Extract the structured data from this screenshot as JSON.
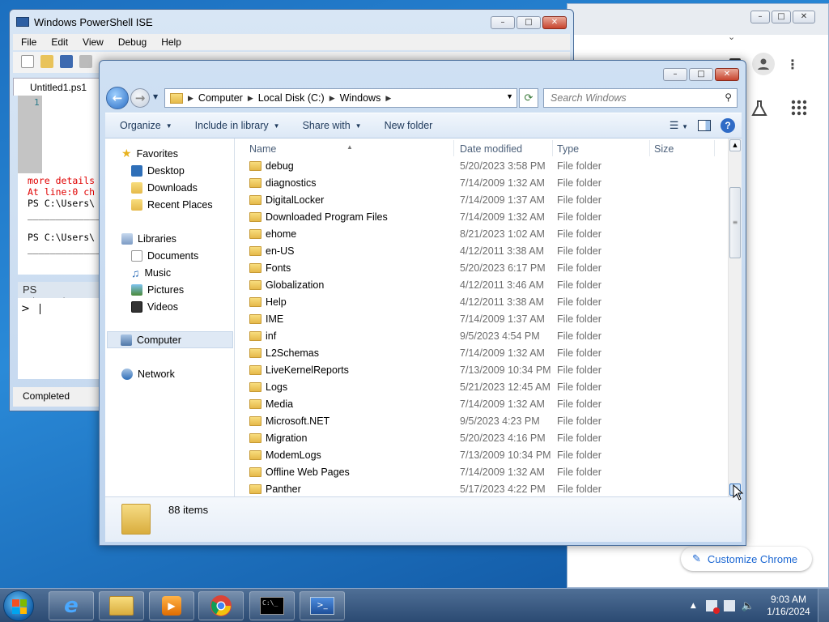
{
  "chrome": {
    "customize_label": "Customize Chrome"
  },
  "ise": {
    "title": "Windows PowerShell ISE",
    "menu": [
      "File",
      "Edit",
      "View",
      "Debug",
      "Help"
    ],
    "tab_label": "Untitled1.ps1",
    "line_number": "1",
    "console_lines": [
      {
        "text": "more details",
        "error": true
      },
      {
        "text": "At line:0 ch",
        "error": true
      },
      {
        "text": "PS C:\\Users\\",
        "error": false
      },
      {
        "text": "_____________",
        "error": false
      },
      {
        "text": "PS C:\\Users\\",
        "error": false
      },
      {
        "text": "_____________",
        "error": false
      }
    ],
    "prompt_label": "PS C:\\Users\\VM",
    "cmd_prompt": ">",
    "status": "Completed"
  },
  "explorer": {
    "address": [
      "Computer",
      "Local Disk (C:)",
      "Windows"
    ],
    "search_placeholder": "Search Windows",
    "commands": [
      "Organize",
      "Include in library",
      "Share with",
      "New folder"
    ],
    "nav": {
      "favorites_label": "Favorites",
      "favorites": [
        "Desktop",
        "Downloads",
        "Recent Places"
      ],
      "libraries_label": "Libraries",
      "libraries": [
        "Documents",
        "Music",
        "Pictures",
        "Videos"
      ],
      "computer": "Computer",
      "network": "Network"
    },
    "columns": {
      "name": "Name",
      "date": "Date modified",
      "type": "Type",
      "size": "Size"
    },
    "files": [
      {
        "name": "debug",
        "date": "5/20/2023 3:58 PM",
        "type": "File folder"
      },
      {
        "name": "diagnostics",
        "date": "7/14/2009 1:32 AM",
        "type": "File folder"
      },
      {
        "name": "DigitalLocker",
        "date": "7/14/2009 1:37 AM",
        "type": "File folder"
      },
      {
        "name": "Downloaded Program Files",
        "date": "7/14/2009 1:32 AM",
        "type": "File folder"
      },
      {
        "name": "ehome",
        "date": "8/21/2023 1:02 AM",
        "type": "File folder"
      },
      {
        "name": "en-US",
        "date": "4/12/2011 3:38 AM",
        "type": "File folder"
      },
      {
        "name": "Fonts",
        "date": "5/20/2023 6:17 PM",
        "type": "File folder"
      },
      {
        "name": "Globalization",
        "date": "4/12/2011 3:46 AM",
        "type": "File folder"
      },
      {
        "name": "Help",
        "date": "4/12/2011 3:38 AM",
        "type": "File folder"
      },
      {
        "name": "IME",
        "date": "7/14/2009 1:37 AM",
        "type": "File folder"
      },
      {
        "name": "inf",
        "date": "9/5/2023 4:54 PM",
        "type": "File folder"
      },
      {
        "name": "L2Schemas",
        "date": "7/14/2009 1:32 AM",
        "type": "File folder"
      },
      {
        "name": "LiveKernelReports",
        "date": "7/13/2009 10:34 PM",
        "type": "File folder"
      },
      {
        "name": "Logs",
        "date": "5/21/2023 12:45 AM",
        "type": "File folder"
      },
      {
        "name": "Media",
        "date": "7/14/2009 1:32 AM",
        "type": "File folder"
      },
      {
        "name": "Microsoft.NET",
        "date": "9/5/2023 4:23 PM",
        "type": "File folder"
      },
      {
        "name": "Migration",
        "date": "5/20/2023 4:16 PM",
        "type": "File folder"
      },
      {
        "name": "ModemLogs",
        "date": "7/13/2009 10:34 PM",
        "type": "File folder"
      },
      {
        "name": "Offline Web Pages",
        "date": "7/14/2009 1:32 AM",
        "type": "File folder"
      },
      {
        "name": "Panther",
        "date": "5/17/2023 4:22 PM",
        "type": "File folder"
      }
    ],
    "item_count": "88 items"
  },
  "taskbar": {
    "time": "9:03 AM",
    "date": "1/16/2024",
    "apps": [
      "ie-icon",
      "explorer-icon",
      "media-player-icon",
      "chrome-icon",
      "cmd-icon",
      "powershell-icon"
    ]
  }
}
